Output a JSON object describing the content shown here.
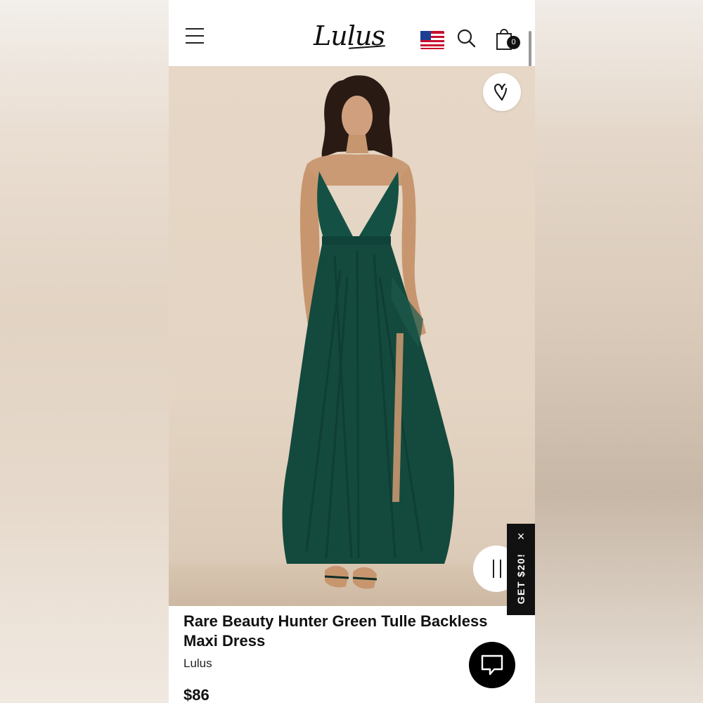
{
  "header": {
    "logo": "Lulus",
    "cart_count": "0"
  },
  "product": {
    "title": "Rare Beauty Hunter Green Tulle Backless Maxi Dress",
    "brand": "Lulus",
    "price": "$86"
  },
  "promo": {
    "label": "GET $20!",
    "close": "×"
  },
  "icons": {
    "menu": "hamburger-icon",
    "flag": "us-flag-icon",
    "search": "search-icon",
    "cart": "shopping-bag-icon",
    "wishlist": "heart-icon",
    "pause": "pause-icon",
    "chat": "chat-icon"
  },
  "colors": {
    "dress": "#12463a",
    "accent": "#000000",
    "background": "#e5d6c5"
  }
}
